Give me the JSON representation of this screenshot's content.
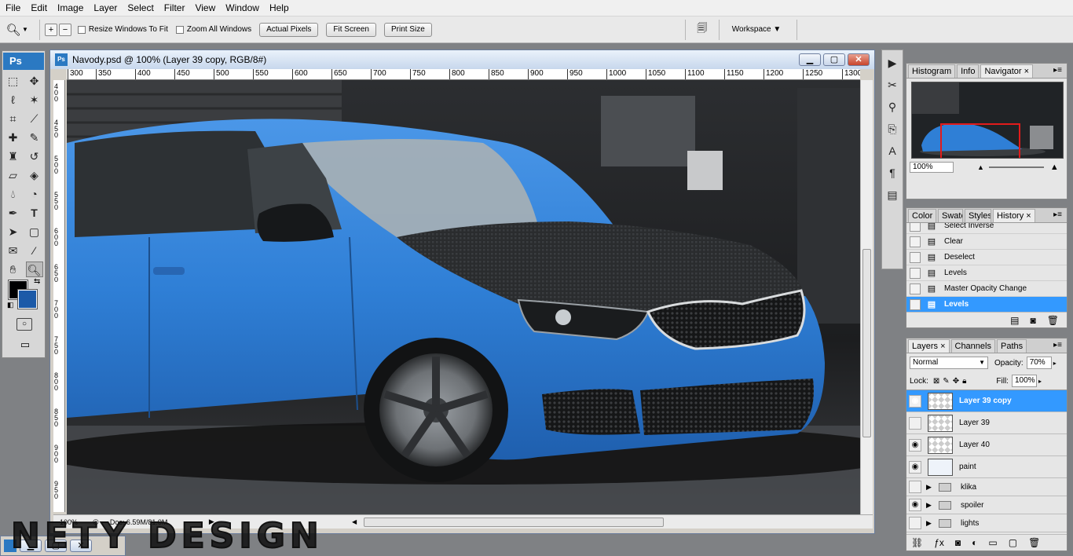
{
  "menu": [
    "File",
    "Edit",
    "Image",
    "Layer",
    "Select",
    "Filter",
    "View",
    "Window",
    "Help"
  ],
  "options": {
    "resize_windows": "Resize Windows To Fit",
    "zoom_all": "Zoom All Windows",
    "actual_pixels": "Actual Pixels",
    "fit_screen": "Fit Screen",
    "print_size": "Print Size",
    "workspace": "Workspace ▼"
  },
  "tools_logo": "Ps",
  "document": {
    "title": "Navody.psd @ 100% (Layer 39 copy, RGB/8#)",
    "zoom": "100%",
    "doc_size": "Doc: 6.59M/81.0M",
    "ruler_marks": [
      "300",
      "350",
      "400",
      "450",
      "500",
      "550",
      "600",
      "650",
      "700",
      "750",
      "800",
      "850",
      "900",
      "950",
      "1000",
      "1050",
      "1100",
      "1150",
      "1200",
      "1250",
      "1300"
    ],
    "vruler_marks": [
      "400",
      "450",
      "500",
      "550",
      "600",
      "650",
      "700",
      "750",
      "800",
      "850",
      "900",
      "950"
    ]
  },
  "navigator": {
    "tabs": [
      "Histogram",
      "Info",
      "Navigator ×"
    ],
    "zoom": "100%"
  },
  "history": {
    "tabs": [
      "Color",
      "Swatc",
      "Styles",
      "History ×"
    ],
    "items": [
      "Select Inverse",
      "Clear",
      "Deselect",
      "Levels",
      "Master Opacity Change",
      "Levels"
    ]
  },
  "layers": {
    "tabs": [
      "Layers ×",
      "Channels",
      "Paths"
    ],
    "blend": "Normal",
    "opacity_label": "Opacity:",
    "opacity": "70%",
    "lock_label": "Lock:",
    "fill_label": "Fill:",
    "fill": "100%",
    "items": [
      "Layer 39 copy",
      "Layer 39",
      "Layer 40",
      "paint"
    ],
    "groups": [
      "klika",
      "spoiler",
      "lights"
    ]
  },
  "watermark": "NETY DESIGN",
  "colors": {
    "car_blue": "#2f7fd6",
    "selection": "#3399ff",
    "navigator_box": "#e21b1b",
    "bg_swatch": "#1c5aa8"
  }
}
